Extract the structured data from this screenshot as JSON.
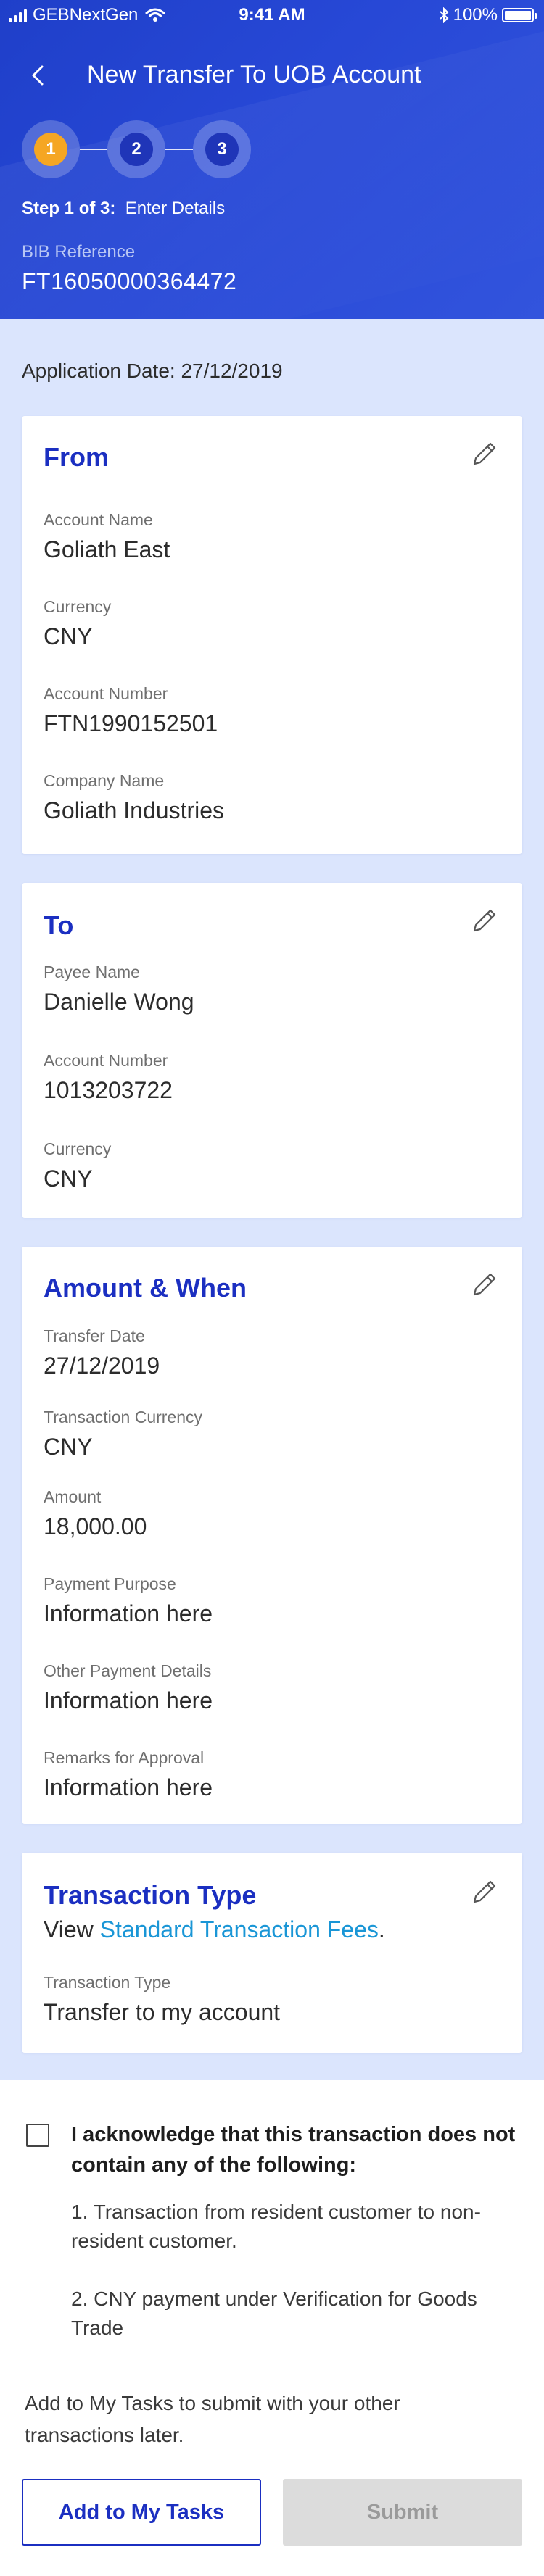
{
  "status_bar": {
    "carrier": "GEBNextGen",
    "time": "9:41 AM",
    "battery": "100%"
  },
  "header": {
    "title": "New Transfer To UOB Account",
    "steps": [
      "1",
      "2",
      "3"
    ],
    "active_step": 1,
    "step_prefix": "Step 1 of 3:",
    "step_name": "Enter Details",
    "bib_label": "BIB Reference",
    "bib_value": "FT16050000364472"
  },
  "application_date": "Application Date: 27/12/2019",
  "from": {
    "title": "From",
    "fields": [
      {
        "label": "Account Name",
        "value": "Goliath East"
      },
      {
        "label": "Currency",
        "value": "CNY"
      },
      {
        "label": "Account Number",
        "value": "FTN1990152501"
      },
      {
        "label": "Company Name",
        "value": "Goliath Industries"
      }
    ]
  },
  "to": {
    "title": "To",
    "fields": [
      {
        "label": "Payee Name",
        "value": "Danielle Wong"
      },
      {
        "label": "Account Number",
        "value": "1013203722"
      },
      {
        "label": "Currency",
        "value": "CNY"
      }
    ]
  },
  "amount": {
    "title": "Amount & When",
    "fields": [
      {
        "label": "Transfer Date",
        "value": "27/12/2019"
      },
      {
        "label": "Transaction Currency",
        "value": "CNY"
      },
      {
        "label": "Amount",
        "value": "18,000.00"
      },
      {
        "label": "Payment Purpose",
        "value": "Information here"
      },
      {
        "label": "Other Payment Details",
        "value": "Information here"
      },
      {
        "label": "Remarks for Approval",
        "value": "Information here"
      }
    ]
  },
  "transaction_type": {
    "title": "Transaction Type",
    "view_text": "View ",
    "fees_link": "Standard Transaction Fees",
    "period": ".",
    "label": "Transaction Type",
    "value": "Transfer to my account"
  },
  "acknowledge": {
    "text": "I acknowledge that this transaction does not contain any of the following:",
    "items": [
      "1. Transaction from resident customer to non-resident customer.",
      "2. CNY payment under Verification for Goods Trade"
    ],
    "checked": false
  },
  "note": "Add to My Tasks to submit with your other transactions later.",
  "buttons": {
    "add_tasks": "Add to My Tasks",
    "submit": "Submit"
  },
  "colors": {
    "header_blue": "#2748d6",
    "title_blue": "#1b2fc1",
    "active_step": "#f5a623",
    "link": "#1a96d6",
    "background": "#dbe5fd",
    "disabled_button": "#dcdcdc"
  }
}
